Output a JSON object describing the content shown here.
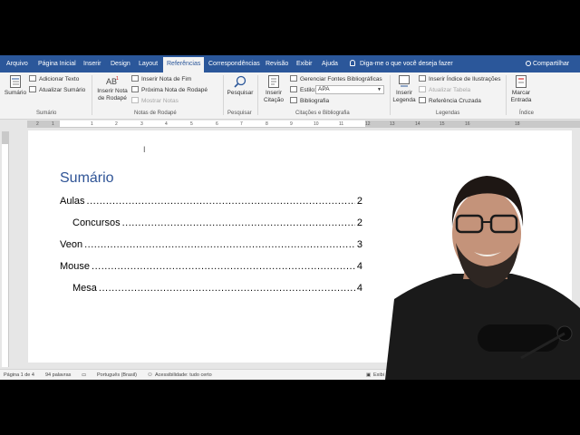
{
  "ribbon_tabs": [
    "Arquivo",
    "Página Inicial",
    "Inserir",
    "Design",
    "Layout",
    "Referências",
    "Correspondências",
    "Revisão",
    "Exibir",
    "Ajuda"
  ],
  "active_tab": "Referências",
  "tell_me": "Diga-me o que você deseja fazer",
  "share": "Compartilhar",
  "groups": {
    "sumario": {
      "label": "Sumário",
      "big_button": "Sumário",
      "add_text": "Adicionar Texto",
      "update": "Atualizar Sumário"
    },
    "notas": {
      "label": "Notas de Rodapé",
      "insert_footnote_1": "Inserir Nota",
      "insert_footnote_2": "de Rodapé",
      "insert_endnote": "Inserir Nota de Fim",
      "next_footnote": "Próxima Nota de Rodapé",
      "show_notes": "Mostrar Notas"
    },
    "pesquisar": {
      "label": "Pesquisar",
      "button": "Pesquisar"
    },
    "citacoes": {
      "label": "Citações e Bibliografia",
      "insert_citation_1": "Inserir",
      "insert_citation_2": "Citação",
      "manage_sources": "Gerenciar Fontes Bibliográficas",
      "style_label": "Estilo:",
      "style_value": "APA",
      "bibliography": "Bibliografia"
    },
    "legendas": {
      "label": "Legendas",
      "insert_caption_1": "Inserir",
      "insert_caption_2": "Legenda",
      "insert_figures_index": "Inserir Índice de Ilustrações",
      "update_table": "Atualizar Tabela",
      "cross_reference": "Referência Cruzada"
    },
    "indice": {
      "label": "Índice",
      "mark_entry_1": "Marcar",
      "mark_entry_2": "Entrada"
    }
  },
  "ruler_numbers": [
    "2",
    "1",
    "1",
    "2",
    "3",
    "4",
    "5",
    "6",
    "7",
    "8",
    "9",
    "10",
    "11",
    "12",
    "13",
    "14",
    "15",
    "16",
    "18"
  ],
  "document": {
    "toc_title": "Sumário",
    "cursor": "I",
    "entries": [
      {
        "text": "Aulas",
        "page": "2",
        "level": 1
      },
      {
        "text": "Concursos",
        "page": "2",
        "level": 2
      },
      {
        "text": "Veon",
        "page": "3",
        "level": 1
      },
      {
        "text": "Mouse",
        "page": "4",
        "level": 1
      },
      {
        "text": "Mesa",
        "page": "4",
        "level": 2
      }
    ]
  },
  "status": {
    "page": "Página 1 de 4",
    "words": "94 palavras",
    "language": "Português (Brasil)",
    "accessibility": "Acessibilidade: tudo certo",
    "view": "Exibi"
  },
  "colors": {
    "ribbon_blue": "#2b579a",
    "heading_blue": "#2f5496"
  }
}
